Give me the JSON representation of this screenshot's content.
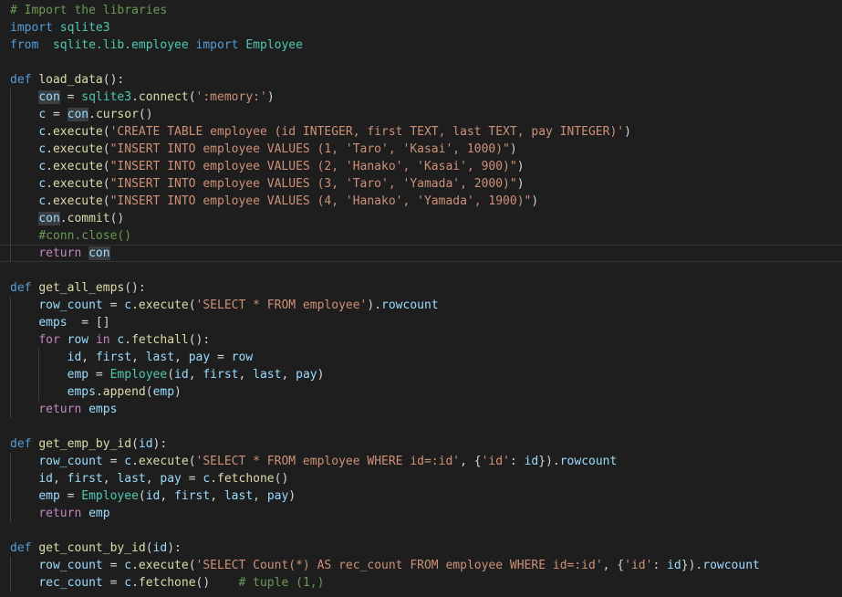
{
  "editor": {
    "lines": [
      {
        "indent": 0,
        "tokens": [
          {
            "c": "comment",
            "t": "# Import the libraries"
          }
        ]
      },
      {
        "indent": 0,
        "tokens": [
          {
            "c": "keyword",
            "t": "import"
          },
          {
            "c": "plain",
            "t": " "
          },
          {
            "c": "class",
            "t": "sqlite3"
          }
        ]
      },
      {
        "indent": 0,
        "tokens": [
          {
            "c": "keyword",
            "t": "from"
          },
          {
            "c": "plain",
            "t": "  "
          },
          {
            "c": "class",
            "t": "sqlite.lib.employee"
          },
          {
            "c": "plain",
            "t": " "
          },
          {
            "c": "keyword",
            "t": "import"
          },
          {
            "c": "plain",
            "t": " "
          },
          {
            "c": "class",
            "t": "Employee"
          }
        ]
      },
      {
        "indent": 0,
        "tokens": []
      },
      {
        "indent": 0,
        "tokens": [
          {
            "c": "keyword",
            "t": "def"
          },
          {
            "c": "plain",
            "t": " "
          },
          {
            "c": "func",
            "t": "load_data"
          },
          {
            "c": "plain",
            "t": "():"
          }
        ]
      },
      {
        "indent": 1,
        "tokens": [
          {
            "c": "var",
            "t": "con",
            "hl": "hl"
          },
          {
            "c": "plain",
            "t": " = "
          },
          {
            "c": "class",
            "t": "sqlite3"
          },
          {
            "c": "plain",
            "t": "."
          },
          {
            "c": "func",
            "t": "connect"
          },
          {
            "c": "plain",
            "t": "("
          },
          {
            "c": "string",
            "t": "':memory:'"
          },
          {
            "c": "plain",
            "t": ")"
          }
        ]
      },
      {
        "indent": 1,
        "tokens": [
          {
            "c": "var",
            "t": "c"
          },
          {
            "c": "plain",
            "t": " = "
          },
          {
            "c": "var",
            "t": "con",
            "hl": "hl"
          },
          {
            "c": "plain",
            "t": "."
          },
          {
            "c": "func",
            "t": "cursor"
          },
          {
            "c": "plain",
            "t": "()"
          }
        ]
      },
      {
        "indent": 1,
        "tokens": [
          {
            "c": "var",
            "t": "c"
          },
          {
            "c": "plain",
            "t": "."
          },
          {
            "c": "func",
            "t": "execute"
          },
          {
            "c": "plain",
            "t": "("
          },
          {
            "c": "string",
            "t": "'CREATE TABLE employee (id INTEGER, first TEXT, last TEXT, pay INTEGER)'"
          },
          {
            "c": "plain",
            "t": ")"
          }
        ]
      },
      {
        "indent": 1,
        "tokens": [
          {
            "c": "var",
            "t": "c"
          },
          {
            "c": "plain",
            "t": "."
          },
          {
            "c": "func",
            "t": "execute"
          },
          {
            "c": "plain",
            "t": "("
          },
          {
            "c": "string",
            "t": "\"INSERT INTO employee VALUES (1, 'Taro', 'Kasai', 1000)\""
          },
          {
            "c": "plain",
            "t": ")"
          }
        ]
      },
      {
        "indent": 1,
        "tokens": [
          {
            "c": "var",
            "t": "c"
          },
          {
            "c": "plain",
            "t": "."
          },
          {
            "c": "func",
            "t": "execute"
          },
          {
            "c": "plain",
            "t": "("
          },
          {
            "c": "string",
            "t": "\"INSERT INTO employee VALUES (2, 'Hanako', 'Kasai', 900)\""
          },
          {
            "c": "plain",
            "t": ")"
          }
        ]
      },
      {
        "indent": 1,
        "tokens": [
          {
            "c": "var",
            "t": "c"
          },
          {
            "c": "plain",
            "t": "."
          },
          {
            "c": "func",
            "t": "execute"
          },
          {
            "c": "plain",
            "t": "("
          },
          {
            "c": "string",
            "t": "\"INSERT INTO employee VALUES (3, 'Taro', 'Yamada', 2000)\""
          },
          {
            "c": "plain",
            "t": ")"
          }
        ]
      },
      {
        "indent": 1,
        "tokens": [
          {
            "c": "var",
            "t": "c"
          },
          {
            "c": "plain",
            "t": "."
          },
          {
            "c": "func",
            "t": "execute"
          },
          {
            "c": "plain",
            "t": "("
          },
          {
            "c": "string",
            "t": "\"INSERT INTO employee VALUES (4, 'Hanako', 'Yamada', 1900)\""
          },
          {
            "c": "plain",
            "t": ")"
          }
        ]
      },
      {
        "indent": 1,
        "tokens": [
          {
            "c": "var",
            "t": "con",
            "hl": "hl"
          },
          {
            "c": "plain",
            "t": "."
          },
          {
            "c": "func",
            "t": "commit"
          },
          {
            "c": "plain",
            "t": "()"
          }
        ]
      },
      {
        "indent": 1,
        "tokens": [
          {
            "c": "comment",
            "t": "#conn.close()"
          }
        ]
      },
      {
        "indent": 1,
        "current": true,
        "tokens": [
          {
            "c": "control",
            "t": "return"
          },
          {
            "c": "plain",
            "t": " "
          },
          {
            "c": "var",
            "t": "con",
            "hl": "hl"
          }
        ]
      },
      {
        "indent": 0,
        "tokens": []
      },
      {
        "indent": 0,
        "tokens": [
          {
            "c": "keyword",
            "t": "def"
          },
          {
            "c": "plain",
            "t": " "
          },
          {
            "c": "func",
            "t": "get_all_emps"
          },
          {
            "c": "plain",
            "t": "():"
          }
        ]
      },
      {
        "indent": 1,
        "tokens": [
          {
            "c": "var",
            "t": "row_count"
          },
          {
            "c": "plain",
            "t": " = "
          },
          {
            "c": "var",
            "t": "c"
          },
          {
            "c": "plain",
            "t": "."
          },
          {
            "c": "func",
            "t": "execute"
          },
          {
            "c": "plain",
            "t": "("
          },
          {
            "c": "string",
            "t": "'SELECT * FROM employee'"
          },
          {
            "c": "plain",
            "t": ")."
          },
          {
            "c": "var",
            "t": "rowcount"
          }
        ]
      },
      {
        "indent": 1,
        "tokens": [
          {
            "c": "var",
            "t": "emps"
          },
          {
            "c": "plain",
            "t": "  = []"
          }
        ]
      },
      {
        "indent": 1,
        "tokens": [
          {
            "c": "control",
            "t": "for"
          },
          {
            "c": "plain",
            "t": " "
          },
          {
            "c": "var",
            "t": "row"
          },
          {
            "c": "plain",
            "t": " "
          },
          {
            "c": "control",
            "t": "in"
          },
          {
            "c": "plain",
            "t": " "
          },
          {
            "c": "var",
            "t": "c"
          },
          {
            "c": "plain",
            "t": "."
          },
          {
            "c": "func",
            "t": "fetchall"
          },
          {
            "c": "plain",
            "t": "():"
          }
        ]
      },
      {
        "indent": 2,
        "tokens": [
          {
            "c": "var",
            "t": "id"
          },
          {
            "c": "plain",
            "t": ", "
          },
          {
            "c": "var",
            "t": "first"
          },
          {
            "c": "plain",
            "t": ", "
          },
          {
            "c": "var",
            "t": "last"
          },
          {
            "c": "plain",
            "t": ", "
          },
          {
            "c": "var",
            "t": "pay"
          },
          {
            "c": "plain",
            "t": " = "
          },
          {
            "c": "var",
            "t": "row"
          }
        ]
      },
      {
        "indent": 2,
        "tokens": [
          {
            "c": "var",
            "t": "emp"
          },
          {
            "c": "plain",
            "t": " = "
          },
          {
            "c": "class",
            "t": "Employee"
          },
          {
            "c": "plain",
            "t": "("
          },
          {
            "c": "var",
            "t": "id"
          },
          {
            "c": "plain",
            "t": ", "
          },
          {
            "c": "var",
            "t": "first"
          },
          {
            "c": "plain",
            "t": ", "
          },
          {
            "c": "var",
            "t": "last"
          },
          {
            "c": "plain",
            "t": ", "
          },
          {
            "c": "var",
            "t": "pay"
          },
          {
            "c": "plain",
            "t": ")"
          }
        ]
      },
      {
        "indent": 2,
        "tokens": [
          {
            "c": "var",
            "t": "emps"
          },
          {
            "c": "plain",
            "t": "."
          },
          {
            "c": "func",
            "t": "append"
          },
          {
            "c": "plain",
            "t": "("
          },
          {
            "c": "var",
            "t": "emp"
          },
          {
            "c": "plain",
            "t": ")"
          }
        ]
      },
      {
        "indent": 1,
        "tokens": [
          {
            "c": "control",
            "t": "return"
          },
          {
            "c": "plain",
            "t": " "
          },
          {
            "c": "var",
            "t": "emps"
          }
        ]
      },
      {
        "indent": 0,
        "tokens": []
      },
      {
        "indent": 0,
        "tokens": [
          {
            "c": "keyword",
            "t": "def"
          },
          {
            "c": "plain",
            "t": " "
          },
          {
            "c": "func",
            "t": "get_emp_by_id"
          },
          {
            "c": "plain",
            "t": "("
          },
          {
            "c": "var",
            "t": "id"
          },
          {
            "c": "plain",
            "t": "):"
          }
        ]
      },
      {
        "indent": 1,
        "tokens": [
          {
            "c": "var",
            "t": "row_count"
          },
          {
            "c": "plain",
            "t": " = "
          },
          {
            "c": "var",
            "t": "c"
          },
          {
            "c": "plain",
            "t": "."
          },
          {
            "c": "func",
            "t": "execute"
          },
          {
            "c": "plain",
            "t": "("
          },
          {
            "c": "string",
            "t": "'SELECT * FROM employee WHERE id=:id'"
          },
          {
            "c": "plain",
            "t": ", {"
          },
          {
            "c": "string",
            "t": "'id'"
          },
          {
            "c": "plain",
            "t": ": "
          },
          {
            "c": "var",
            "t": "id"
          },
          {
            "c": "plain",
            "t": "})."
          },
          {
            "c": "var",
            "t": "rowcount"
          }
        ]
      },
      {
        "indent": 1,
        "tokens": [
          {
            "c": "var",
            "t": "id"
          },
          {
            "c": "plain",
            "t": ", "
          },
          {
            "c": "var",
            "t": "first"
          },
          {
            "c": "plain",
            "t": ", "
          },
          {
            "c": "var",
            "t": "last"
          },
          {
            "c": "plain",
            "t": ", "
          },
          {
            "c": "var",
            "t": "pay"
          },
          {
            "c": "plain",
            "t": " = "
          },
          {
            "c": "var",
            "t": "c"
          },
          {
            "c": "plain",
            "t": "."
          },
          {
            "c": "func",
            "t": "fetchone"
          },
          {
            "c": "plain",
            "t": "()"
          }
        ]
      },
      {
        "indent": 1,
        "tokens": [
          {
            "c": "var",
            "t": "emp"
          },
          {
            "c": "plain",
            "t": " = "
          },
          {
            "c": "class",
            "t": "Employee"
          },
          {
            "c": "plain",
            "t": "("
          },
          {
            "c": "var",
            "t": "id"
          },
          {
            "c": "plain",
            "t": ", "
          },
          {
            "c": "var",
            "t": "first"
          },
          {
            "c": "plain",
            "t": ", "
          },
          {
            "c": "var",
            "t": "last"
          },
          {
            "c": "plain",
            "t": ", "
          },
          {
            "c": "var",
            "t": "pay"
          },
          {
            "c": "plain",
            "t": ")"
          }
        ]
      },
      {
        "indent": 1,
        "tokens": [
          {
            "c": "control",
            "t": "return"
          },
          {
            "c": "plain",
            "t": " "
          },
          {
            "c": "var",
            "t": "emp"
          }
        ]
      },
      {
        "indent": 0,
        "tokens": []
      },
      {
        "indent": 0,
        "tokens": [
          {
            "c": "keyword",
            "t": "def"
          },
          {
            "c": "plain",
            "t": " "
          },
          {
            "c": "func",
            "t": "get_count_by_id"
          },
          {
            "c": "plain",
            "t": "("
          },
          {
            "c": "var",
            "t": "id"
          },
          {
            "c": "plain",
            "t": "):"
          }
        ]
      },
      {
        "indent": 1,
        "tokens": [
          {
            "c": "var",
            "t": "row_count"
          },
          {
            "c": "plain",
            "t": " = "
          },
          {
            "c": "var",
            "t": "c"
          },
          {
            "c": "plain",
            "t": "."
          },
          {
            "c": "func",
            "t": "execute"
          },
          {
            "c": "plain",
            "t": "("
          },
          {
            "c": "string",
            "t": "'SELECT Count(*) AS rec_count FROM employee WHERE id=:id'"
          },
          {
            "c": "plain",
            "t": ", {"
          },
          {
            "c": "string",
            "t": "'id'"
          },
          {
            "c": "plain",
            "t": ": "
          },
          {
            "c": "var",
            "t": "id"
          },
          {
            "c": "plain",
            "t": "})."
          },
          {
            "c": "var",
            "t": "rowcount"
          }
        ]
      },
      {
        "indent": 1,
        "tokens": [
          {
            "c": "var",
            "t": "rec_count"
          },
          {
            "c": "plain",
            "t": " = "
          },
          {
            "c": "var",
            "t": "c"
          },
          {
            "c": "plain",
            "t": "."
          },
          {
            "c": "func",
            "t": "fetchone"
          },
          {
            "c": "plain",
            "t": "()    "
          },
          {
            "c": "comment",
            "t": "# tuple (1,)"
          }
        ]
      }
    ]
  },
  "colors": {
    "background": "#1e1e1e",
    "comment": "#6a9955",
    "keyword": "#569cd6",
    "control": "#c586c0",
    "function": "#dcdcaa",
    "class": "#4ec9b0",
    "variable": "#9cdcfe",
    "string": "#ce9178",
    "highlight": "#3a3d41"
  }
}
